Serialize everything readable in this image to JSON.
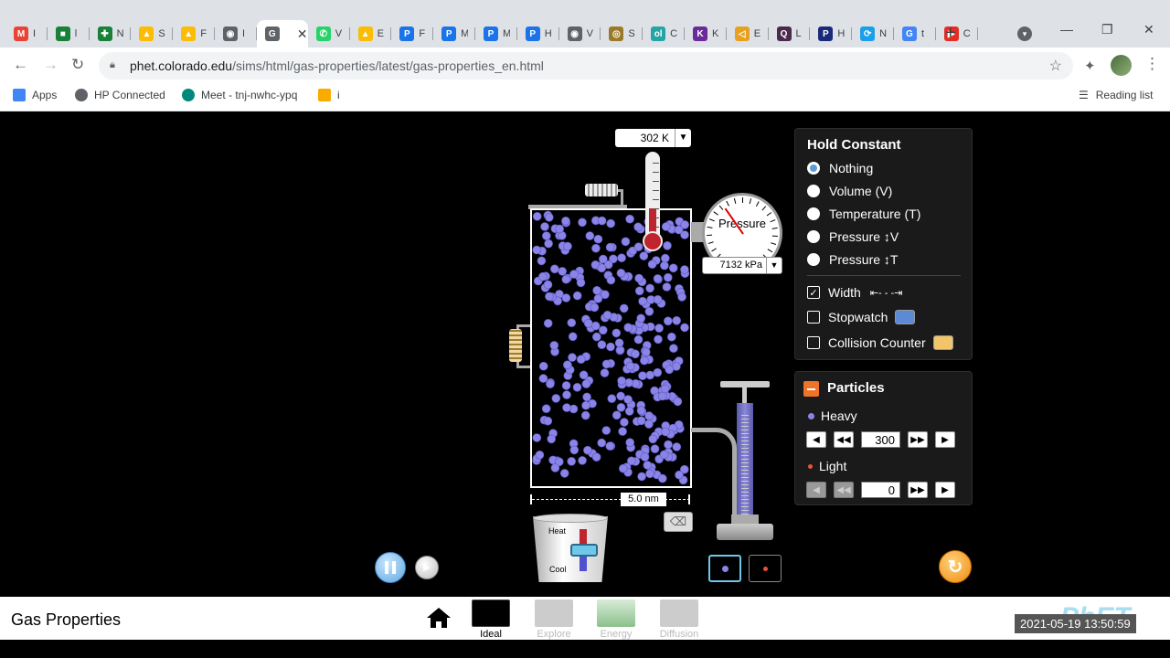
{
  "browser": {
    "tabs": [
      {
        "letter": "M",
        "short": "I",
        "color": "#ea4335"
      },
      {
        "letter": "■",
        "short": "l",
        "color": "#188038"
      },
      {
        "letter": "✚",
        "short": "N",
        "color": "#188038"
      },
      {
        "letter": "▲",
        "short": "S",
        "color": "#fbbc04"
      },
      {
        "letter": "▲",
        "short": "F",
        "color": "#fbbc04"
      },
      {
        "letter": "◉",
        "short": "I",
        "color": "#5f6368"
      },
      {
        "letter": "G",
        "short": "",
        "color": "#5f6368",
        "active": true
      },
      {
        "letter": "✆",
        "short": "V",
        "color": "#25d366"
      },
      {
        "letter": "▲",
        "short": "E",
        "color": "#fbbc04"
      },
      {
        "letter": "P",
        "short": "F",
        "color": "#1a73e8"
      },
      {
        "letter": "P",
        "short": "M",
        "color": "#1a73e8"
      },
      {
        "letter": "P",
        "short": "M",
        "color": "#1a73e8"
      },
      {
        "letter": "P",
        "short": "H",
        "color": "#1a73e8"
      },
      {
        "letter": "◉",
        "short": "V",
        "color": "#5f6368"
      },
      {
        "letter": "◎",
        "short": "S",
        "color": "#9a7a2a"
      },
      {
        "letter": "ol",
        "short": "C",
        "color": "#23a5a5"
      },
      {
        "letter": "K",
        "short": "K",
        "color": "#6a2a9a"
      },
      {
        "letter": "◁",
        "short": "E",
        "color": "#e8a020"
      },
      {
        "letter": "Q",
        "short": "L",
        "color": "#4a2a4a"
      },
      {
        "letter": "P",
        "short": "H",
        "color": "#1a2a7a"
      },
      {
        "letter": "⟳",
        "short": "N",
        "color": "#1aa0e8"
      },
      {
        "letter": "G",
        "short": "t",
        "color": "#4285f4"
      },
      {
        "letter": "▶",
        "short": "C",
        "color": "#e52d27"
      }
    ],
    "url_host": "phet.colorado.edu",
    "url_path": "/sims/html/gas-properties/latest/gas-properties_en.html",
    "bookmarks": [
      {
        "label": "Apps",
        "color": "#4285f4"
      },
      {
        "label": "HP Connected",
        "color": "#5f6368"
      },
      {
        "label": "Meet - tnj-nwhc-ypq",
        "color": "#00897b"
      },
      {
        "label": "i",
        "color": "#f9ab00"
      }
    ],
    "reading_list": "Reading list"
  },
  "sim": {
    "temperature": "302 K",
    "pressure_label": "Pressure",
    "pressure": "7132 kPa",
    "width": "5.0 nm",
    "heat_label": "Heat",
    "cool_label": "Cool",
    "hold_constant": {
      "title": "Hold Constant",
      "options": [
        "Nothing",
        "Volume (V)",
        "Temperature (T)",
        "Pressure ↕V",
        "Pressure ↕T"
      ],
      "selected_index": 0
    },
    "checks": [
      {
        "label": "Width",
        "checked": true
      },
      {
        "label": "Stopwatch",
        "checked": false
      },
      {
        "label": "Collision Counter",
        "checked": false
      }
    ],
    "particles": {
      "title": "Particles",
      "heavy_label": "Heavy",
      "heavy_count": "300",
      "light_label": "Light",
      "light_count": "0"
    },
    "colors": {
      "heavy": "#8a84e6",
      "light": "#e8533a",
      "accent": "#f0732a"
    }
  },
  "navbar": {
    "title": "Gas Properties",
    "screens": [
      {
        "label": "Ideal",
        "active": true
      },
      {
        "label": "Explore",
        "active": false
      },
      {
        "label": "Energy",
        "active": false
      },
      {
        "label": "Diffusion",
        "active": false
      }
    ],
    "timestamp": "2021-05-19 13:50:59"
  }
}
